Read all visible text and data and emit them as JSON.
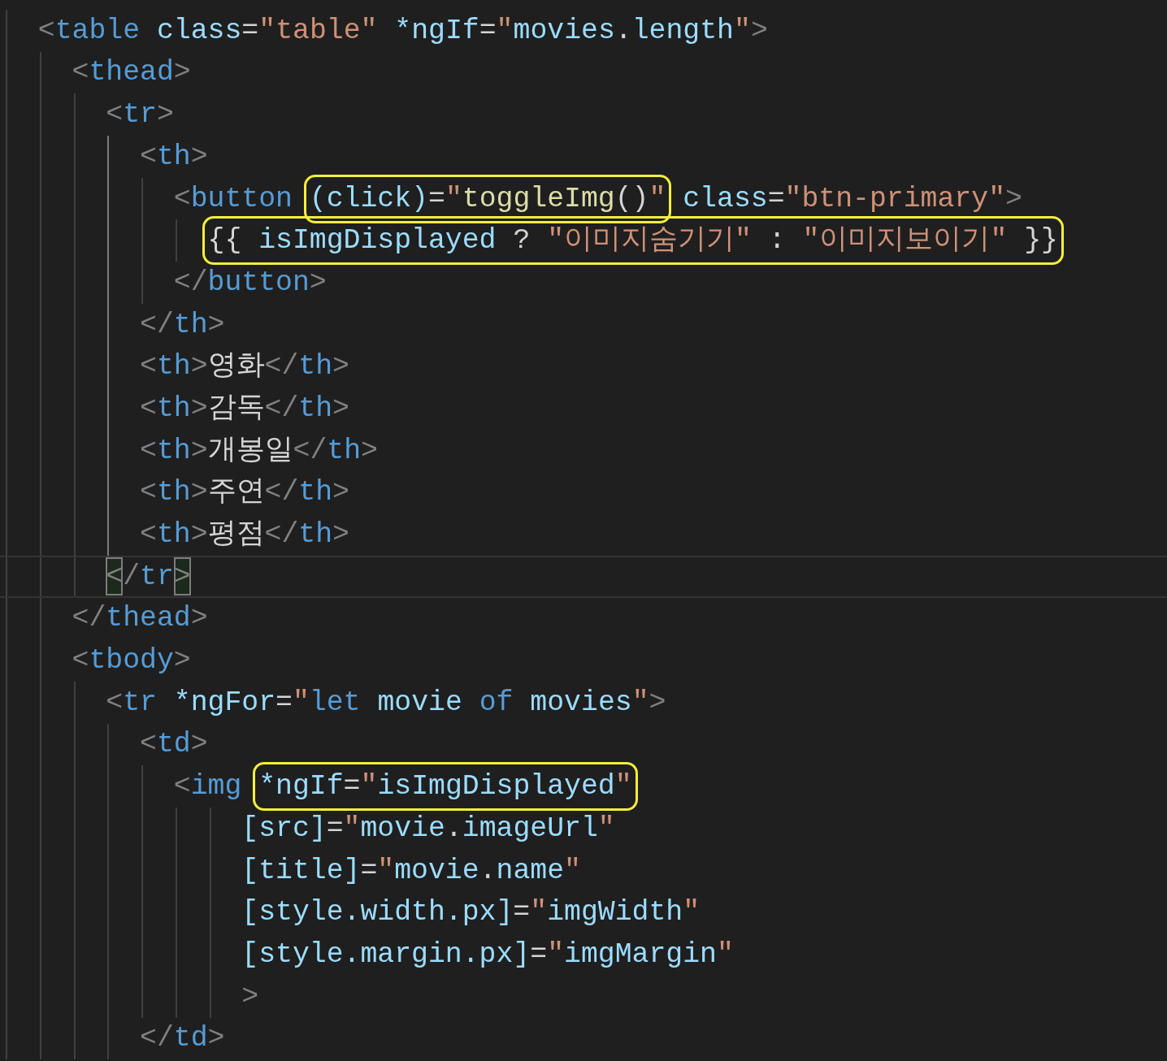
{
  "editor": {
    "lines": [
      {
        "kind": "code",
        "current": false,
        "segments": [
          {
            "highlighted": false,
            "tokens": [
              {
                "kind": "punct",
                "text": "<"
              },
              {
                "kind": "tag",
                "text": "table"
              },
              {
                "kind": "attr",
                "text": " class"
              },
              {
                "kind": "plain",
                "text": "="
              },
              {
                "kind": "string",
                "text": "\"table\""
              },
              {
                "kind": "attr",
                "text": " *ngIf"
              },
              {
                "kind": "plain",
                "text": "="
              },
              {
                "kind": "string",
                "text": "\""
              },
              {
                "kind": "attr",
                "text": "movies"
              },
              {
                "kind": "plain",
                "text": "."
              },
              {
                "kind": "attr",
                "text": "length"
              },
              {
                "kind": "string",
                "text": "\""
              },
              {
                "kind": "punct",
                "text": ">"
              }
            ]
          }
        ],
        "children": [
          {
            "kind": "code",
            "current": false,
            "segments": [
              {
                "highlighted": false,
                "tokens": [
                  {
                    "kind": "punct",
                    "text": "<"
                  },
                  {
                    "kind": "tag",
                    "text": "thead"
                  },
                  {
                    "kind": "punct",
                    "text": ">"
                  }
                ]
              }
            ],
            "children": [
              {
                "kind": "code",
                "current": false,
                "segments": [
                  {
                    "highlighted": false,
                    "tokens": [
                      {
                        "kind": "punct",
                        "text": "<"
                      },
                      {
                        "kind": "tag",
                        "text": "tr"
                      },
                      {
                        "kind": "punct",
                        "text": ">"
                      }
                    ]
                  }
                ],
                "children": [
                  {
                    "kind": "code",
                    "current": false,
                    "segments": [
                      {
                        "highlighted": false,
                        "tokens": [
                          {
                            "kind": "punct",
                            "text": "<"
                          },
                          {
                            "kind": "tag",
                            "text": "th"
                          },
                          {
                            "kind": "punct",
                            "text": ">"
                          }
                        ]
                      }
                    ],
                    "children": [
                      {
                        "kind": "code",
                        "current": false,
                        "segments": [
                          {
                            "highlighted": false,
                            "tokens": [
                              {
                                "kind": "punct",
                                "text": "<"
                              },
                              {
                                "kind": "tag",
                                "text": "button "
                              }
                            ]
                          },
                          {
                            "highlighted": true,
                            "tokens": [
                              {
                                "kind": "attr",
                                "text": "(click)"
                              },
                              {
                                "kind": "plain",
                                "text": "="
                              },
                              {
                                "kind": "string",
                                "text": "\""
                              },
                              {
                                "kind": "function",
                                "text": "toggleImg"
                              },
                              {
                                "kind": "plain",
                                "text": "()"
                              },
                              {
                                "kind": "string",
                                "text": "\""
                              }
                            ]
                          },
                          {
                            "highlighted": false,
                            "tokens": [
                              {
                                "kind": "attr",
                                "text": " class"
                              },
                              {
                                "kind": "plain",
                                "text": "="
                              },
                              {
                                "kind": "string",
                                "text": "\"btn-primary\""
                              },
                              {
                                "kind": "punct",
                                "text": ">"
                              }
                            ]
                          }
                        ],
                        "children": [
                          {
                            "kind": "code",
                            "current": false,
                            "segments": [
                              {
                                "highlighted": true,
                                "tokens": [
                                  {
                                    "kind": "plain",
                                    "text": "{{ "
                                  },
                                  {
                                    "kind": "attr",
                                    "text": "isImgDisplayed"
                                  },
                                  {
                                    "kind": "plain",
                                    "text": " ? "
                                  },
                                  {
                                    "kind": "string",
                                    "text": "\"이미지숨기기\""
                                  },
                                  {
                                    "kind": "plain",
                                    "text": " : "
                                  },
                                  {
                                    "kind": "string",
                                    "text": "\"이미지보이기\""
                                  },
                                  {
                                    "kind": "plain",
                                    "text": " }}"
                                  }
                                ]
                              }
                            ]
                          }
                        ]
                      },
                      {
                        "kind": "code",
                        "current": false,
                        "segments": [
                          {
                            "highlighted": false,
                            "tokens": [
                              {
                                "kind": "punct",
                                "text": "</"
                              },
                              {
                                "kind": "tag",
                                "text": "button"
                              },
                              {
                                "kind": "punct",
                                "text": ">"
                              }
                            ]
                          }
                        ]
                      }
                    ]
                  },
                  {
                    "kind": "code",
                    "current": false,
                    "segments": [
                      {
                        "highlighted": false,
                        "tokens": [
                          {
                            "kind": "punct",
                            "text": "</"
                          },
                          {
                            "kind": "tag",
                            "text": "th"
                          },
                          {
                            "kind": "punct",
                            "text": ">"
                          }
                        ]
                      }
                    ]
                  },
                  {
                    "kind": "code",
                    "current": false,
                    "segments": [
                      {
                        "highlighted": false,
                        "tokens": [
                          {
                            "kind": "punct",
                            "text": "<"
                          },
                          {
                            "kind": "tag",
                            "text": "th"
                          },
                          {
                            "kind": "punct",
                            "text": ">"
                          },
                          {
                            "kind": "plain",
                            "text": "영화"
                          },
                          {
                            "kind": "punct",
                            "text": "</"
                          },
                          {
                            "kind": "tag",
                            "text": "th"
                          },
                          {
                            "kind": "punct",
                            "text": ">"
                          }
                        ]
                      }
                    ]
                  },
                  {
                    "kind": "code",
                    "current": false,
                    "segments": [
                      {
                        "highlighted": false,
                        "tokens": [
                          {
                            "kind": "punct",
                            "text": "<"
                          },
                          {
                            "kind": "tag",
                            "text": "th"
                          },
                          {
                            "kind": "punct",
                            "text": ">"
                          },
                          {
                            "kind": "plain",
                            "text": "감독"
                          },
                          {
                            "kind": "punct",
                            "text": "</"
                          },
                          {
                            "kind": "tag",
                            "text": "th"
                          },
                          {
                            "kind": "punct",
                            "text": ">"
                          }
                        ]
                      }
                    ]
                  },
                  {
                    "kind": "code",
                    "current": false,
                    "segments": [
                      {
                        "highlighted": false,
                        "tokens": [
                          {
                            "kind": "punct",
                            "text": "<"
                          },
                          {
                            "kind": "tag",
                            "text": "th"
                          },
                          {
                            "kind": "punct",
                            "text": ">"
                          },
                          {
                            "kind": "plain",
                            "text": "개봉일"
                          },
                          {
                            "kind": "punct",
                            "text": "</"
                          },
                          {
                            "kind": "tag",
                            "text": "th"
                          },
                          {
                            "kind": "punct",
                            "text": ">"
                          }
                        ]
                      }
                    ]
                  },
                  {
                    "kind": "code",
                    "current": false,
                    "segments": [
                      {
                        "highlighted": false,
                        "tokens": [
                          {
                            "kind": "punct",
                            "text": "<"
                          },
                          {
                            "kind": "tag",
                            "text": "th"
                          },
                          {
                            "kind": "punct",
                            "text": ">"
                          },
                          {
                            "kind": "plain",
                            "text": "주연"
                          },
                          {
                            "kind": "punct",
                            "text": "</"
                          },
                          {
                            "kind": "tag",
                            "text": "th"
                          },
                          {
                            "kind": "punct",
                            "text": ">"
                          }
                        ]
                      }
                    ]
                  },
                  {
                    "kind": "code",
                    "current": false,
                    "segments": [
                      {
                        "highlighted": false,
                        "tokens": [
                          {
                            "kind": "punct",
                            "text": "<"
                          },
                          {
                            "kind": "tag",
                            "text": "th"
                          },
                          {
                            "kind": "punct",
                            "text": ">"
                          },
                          {
                            "kind": "plain",
                            "text": "평점"
                          },
                          {
                            "kind": "punct",
                            "text": "</"
                          },
                          {
                            "kind": "tag",
                            "text": "th"
                          },
                          {
                            "kind": "punct",
                            "text": ">"
                          }
                        ]
                      }
                    ]
                  }
                ]
              },
              {
                "kind": "code",
                "current": true,
                "segments": [
                  {
                    "highlighted": false,
                    "tokens": [
                      {
                        "kind": "punct",
                        "text": "<",
                        "matched": true
                      },
                      {
                        "kind": "punct",
                        "text": "/",
                        "matched": false
                      },
                      {
                        "kind": "tag",
                        "text": "tr",
                        "matched": false
                      },
                      {
                        "kind": "punct",
                        "text": ">",
                        "matched": true
                      }
                    ]
                  }
                ]
              }
            ]
          },
          {
            "kind": "code",
            "current": false,
            "segments": [
              {
                "highlighted": false,
                "tokens": [
                  {
                    "kind": "punct",
                    "text": "</"
                  },
                  {
                    "kind": "tag",
                    "text": "thead"
                  },
                  {
                    "kind": "punct",
                    "text": ">"
                  }
                ]
              }
            ]
          },
          {
            "kind": "code",
            "current": false,
            "segments": [
              {
                "highlighted": false,
                "tokens": [
                  {
                    "kind": "punct",
                    "text": "<"
                  },
                  {
                    "kind": "tag",
                    "text": "tbody"
                  },
                  {
                    "kind": "punct",
                    "text": ">"
                  }
                ]
              }
            ],
            "children": [
              {
                "kind": "code",
                "current": false,
                "segments": [
                  {
                    "highlighted": false,
                    "tokens": [
                      {
                        "kind": "punct",
                        "text": "<"
                      },
                      {
                        "kind": "tag",
                        "text": "tr"
                      },
                      {
                        "kind": "attr",
                        "text": " *ngFor"
                      },
                      {
                        "kind": "plain",
                        "text": "="
                      },
                      {
                        "kind": "string",
                        "text": "\""
                      },
                      {
                        "kind": "keyword",
                        "text": "let"
                      },
                      {
                        "kind": "attr",
                        "text": " movie"
                      },
                      {
                        "kind": "keyword",
                        "text": " of"
                      },
                      {
                        "kind": "attr",
                        "text": " movies"
                      },
                      {
                        "kind": "string",
                        "text": "\""
                      },
                      {
                        "kind": "punct",
                        "text": ">"
                      }
                    ]
                  }
                ],
                "children": [
                  {
                    "kind": "code",
                    "current": false,
                    "segments": [
                      {
                        "highlighted": false,
                        "tokens": [
                          {
                            "kind": "punct",
                            "text": "<"
                          },
                          {
                            "kind": "tag",
                            "text": "td"
                          },
                          {
                            "kind": "punct",
                            "text": ">"
                          }
                        ]
                      }
                    ],
                    "children": [
                      {
                        "kind": "code",
                        "current": false,
                        "segments": [
                          {
                            "highlighted": false,
                            "tokens": [
                              {
                                "kind": "punct",
                                "text": "<"
                              },
                              {
                                "kind": "tag",
                                "text": "img "
                              }
                            ]
                          },
                          {
                            "highlighted": true,
                            "tokens": [
                              {
                                "kind": "attr",
                                "text": "*ngIf"
                              },
                              {
                                "kind": "plain",
                                "text": "="
                              },
                              {
                                "kind": "string",
                                "text": "\""
                              },
                              {
                                "kind": "attr",
                                "text": "isImgDisplayed"
                              },
                              {
                                "kind": "string",
                                "text": "\""
                              }
                            ]
                          }
                        ],
                        "children": [
                          {
                            "kind": "continuation",
                            "current": false,
                            "segments": [
                              {
                                "highlighted": false,
                                "tokens": [
                                  {
                                    "kind": "attr",
                                    "text": "[src]"
                                  },
                                  {
                                    "kind": "plain",
                                    "text": "="
                                  },
                                  {
                                    "kind": "string",
                                    "text": "\""
                                  },
                                  {
                                    "kind": "attr",
                                    "text": "movie"
                                  },
                                  {
                                    "kind": "plain",
                                    "text": "."
                                  },
                                  {
                                    "kind": "attr",
                                    "text": "imageUrl"
                                  },
                                  {
                                    "kind": "string",
                                    "text": "\""
                                  }
                                ]
                              }
                            ]
                          },
                          {
                            "kind": "continuation",
                            "current": false,
                            "segments": [
                              {
                                "highlighted": false,
                                "tokens": [
                                  {
                                    "kind": "attr",
                                    "text": "[title]"
                                  },
                                  {
                                    "kind": "plain",
                                    "text": "="
                                  },
                                  {
                                    "kind": "string",
                                    "text": "\""
                                  },
                                  {
                                    "kind": "attr",
                                    "text": "movie"
                                  },
                                  {
                                    "kind": "plain",
                                    "text": "."
                                  },
                                  {
                                    "kind": "attr",
                                    "text": "name"
                                  },
                                  {
                                    "kind": "string",
                                    "text": "\""
                                  }
                                ]
                              }
                            ]
                          },
                          {
                            "kind": "continuation",
                            "current": false,
                            "segments": [
                              {
                                "highlighted": false,
                                "tokens": [
                                  {
                                    "kind": "attr",
                                    "text": "[style.width.px]"
                                  },
                                  {
                                    "kind": "plain",
                                    "text": "="
                                  },
                                  {
                                    "kind": "string",
                                    "text": "\""
                                  },
                                  {
                                    "kind": "attr",
                                    "text": "imgWidth"
                                  },
                                  {
                                    "kind": "string",
                                    "text": "\""
                                  }
                                ]
                              }
                            ]
                          },
                          {
                            "kind": "continuation",
                            "current": false,
                            "segments": [
                              {
                                "highlighted": false,
                                "tokens": [
                                  {
                                    "kind": "attr",
                                    "text": "[style.margin.px]"
                                  },
                                  {
                                    "kind": "plain",
                                    "text": "="
                                  },
                                  {
                                    "kind": "string",
                                    "text": "\""
                                  },
                                  {
                                    "kind": "attr",
                                    "text": "imgMargin"
                                  },
                                  {
                                    "kind": "string",
                                    "text": "\""
                                  }
                                ]
                              }
                            ]
                          },
                          {
                            "kind": "continuation",
                            "current": false,
                            "segments": [
                              {
                                "highlighted": false,
                                "tokens": [
                                  {
                                    "kind": "punct",
                                    "text": ">"
                                  }
                                ]
                              }
                            ]
                          }
                        ]
                      }
                    ]
                  },
                  {
                    "kind": "code",
                    "current": false,
                    "segments": [
                      {
                        "highlighted": false,
                        "tokens": [
                          {
                            "kind": "punct",
                            "text": "</"
                          },
                          {
                            "kind": "tag",
                            "text": "td"
                          },
                          {
                            "kind": "punct",
                            "text": ">"
                          }
                        ]
                      }
                    ]
                  }
                ]
              }
            ]
          }
        ]
      }
    ]
  }
}
